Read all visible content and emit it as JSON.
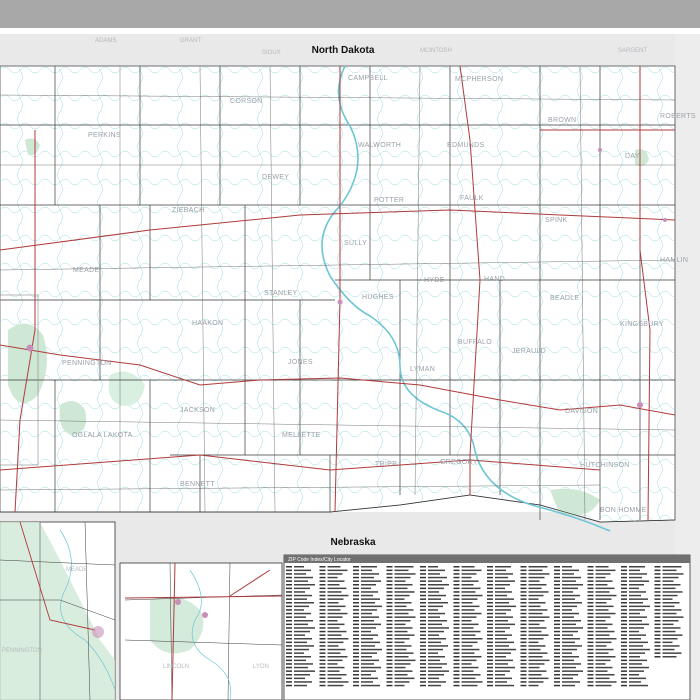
{
  "map": {
    "state_labels": {
      "north": "North Dakota",
      "south": "Nebraska"
    },
    "counties": [
      "PERKINS",
      "CORSON",
      "MCPHERSON",
      "EDMUNDS",
      "WALWORTH",
      "DEWEY",
      "ZIEBACH",
      "FAULK",
      "MEADE",
      "STANLEY",
      "HUGHES",
      "HYDE",
      "HAAKON",
      "PENNINGTON",
      "JONES",
      "LYMAN",
      "BUFFALO",
      "JERAULD",
      "MELLETTE",
      "OGLALA LAKOTA",
      "TRIPP",
      "GREGORY",
      "BENNETT",
      "SPINK",
      "BEADLE",
      "DAY",
      "HAMLIN",
      "DAVISON",
      "HUTCHINSON",
      "CAMPBELL",
      "BROWN",
      "ROBERTS",
      "POTTER",
      "SULLY",
      "HAND",
      "KINGSBURY",
      "BON HOMME",
      "JACKSON"
    ],
    "outside_counties": [
      "ADAMS",
      "GRANT",
      "SIOUX",
      "MCINTOSH",
      "SARGENT"
    ],
    "inset_labels": [
      "MEADE",
      "PENNINGTON",
      "LINCOLN",
      "LYON"
    ],
    "index": {
      "title": "ZIP Code Index/City Locator"
    }
  },
  "colors": {
    "border_gray": "#aaaaaa",
    "road_red": "#b03a3a",
    "zip_cyan": "#6ec6d4",
    "county_line": "#3a3a3a",
    "park_green": "#cfe8d6",
    "outside_gray": "#e6e6e6"
  }
}
